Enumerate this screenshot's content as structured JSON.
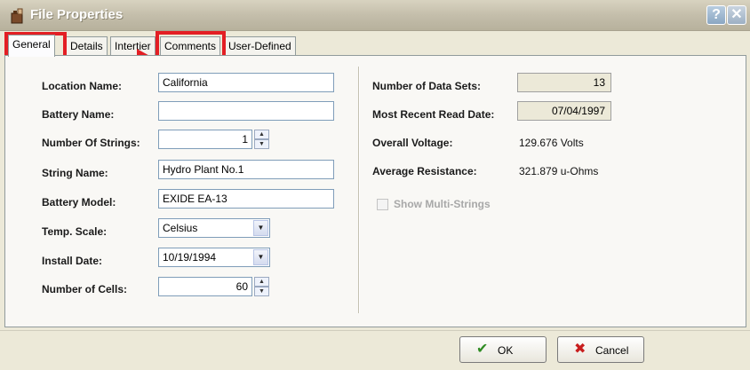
{
  "window": {
    "title": "File Properties"
  },
  "tabs": [
    {
      "label": "General"
    },
    {
      "label": "Details"
    },
    {
      "label": "Intertier"
    },
    {
      "label": "Comments"
    },
    {
      "label": "User-Defined"
    }
  ],
  "left": {
    "location_name": {
      "label": "Location Name:",
      "value": "California"
    },
    "battery_name": {
      "label": "Battery Name:",
      "value": ""
    },
    "number_of_strings": {
      "label": "Number Of Strings:",
      "value": "1"
    },
    "string_name": {
      "label": "String Name:",
      "value": "Hydro Plant No.1"
    },
    "battery_model": {
      "label": "Battery Model:",
      "value": "EXIDE EA-13"
    },
    "temp_scale": {
      "label": "Temp. Scale:",
      "value": "Celsius"
    },
    "install_date": {
      "label": "Install Date:",
      "value": "10/19/1994"
    },
    "number_of_cells": {
      "label": "Number of Cells:",
      "value": "60"
    }
  },
  "right": {
    "number_of_data_sets": {
      "label": "Number of Data Sets:",
      "value": "13"
    },
    "most_recent_read_date": {
      "label": "Most Recent Read Date:",
      "value": "07/04/1997"
    },
    "overall_voltage": {
      "label": "Overall Voltage:",
      "value": "129.676 Volts"
    },
    "average_resistance": {
      "label": "Average Resistance:",
      "value": "321.879 u-Ohms"
    },
    "show_multi_strings": {
      "label": "Show Multi-Strings",
      "checked": false,
      "enabled": false
    }
  },
  "buttons": {
    "ok": "OK",
    "cancel": "Cancel"
  },
  "colors": {
    "highlight": "#e31e24",
    "ok_check": "#2e8b22",
    "cancel_x": "#c81e1e"
  }
}
